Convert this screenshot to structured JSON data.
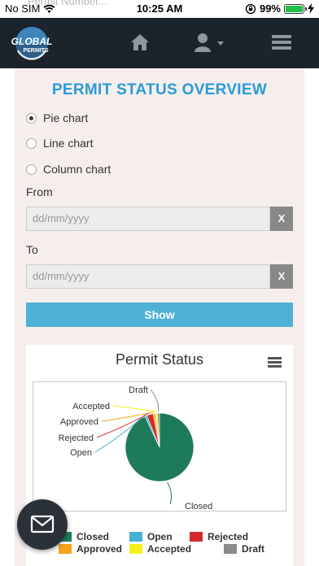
{
  "status_bar": {
    "carrier": "No SIM",
    "ghost_text": "Permit Number...",
    "time": "10:25 AM",
    "battery": "99%",
    "battery_level": 0.99
  },
  "navbar": {
    "logo_word1": "GLOBAL",
    "logo_word2": "PERMITS",
    "icons": [
      "home-icon",
      "user-icon",
      "menu-icon"
    ]
  },
  "page": {
    "title": "PERMIT STATUS OVERVIEW",
    "chart_types": [
      {
        "label": "Pie chart",
        "checked": true
      },
      {
        "label": "Line chart",
        "checked": false
      },
      {
        "label": "Column chart",
        "checked": false
      }
    ],
    "from_label": "From",
    "to_label": "To",
    "from_placeholder": "dd/mm/yyyy",
    "to_placeholder": "dd/mm/yyyy",
    "clear_label": "X",
    "show_label": "Show"
  },
  "chart_data": {
    "type": "pie",
    "title": "Permit Status",
    "slices": [
      {
        "name": "Closed",
        "value": 93,
        "color": "#1e7b5a"
      },
      {
        "name": "Open",
        "value": 1,
        "color": "#4ab0d0"
      },
      {
        "name": "Rejected",
        "value": 3,
        "color": "#d22a2a"
      },
      {
        "name": "Approved",
        "value": 1,
        "color": "#f5a21b"
      },
      {
        "name": "Accepted",
        "value": 1,
        "color": "#f5f01b"
      },
      {
        "name": "Draft",
        "value": 1,
        "color": "#8a8a8a"
      }
    ],
    "legend_placement": "bottom"
  },
  "colors": {
    "nav_background": "#1b232c",
    "accent": "#2a9bd6",
    "show_button": "#4eb1d6",
    "page_background": "#f6eeed"
  },
  "fab_icon": "mail-icon"
}
